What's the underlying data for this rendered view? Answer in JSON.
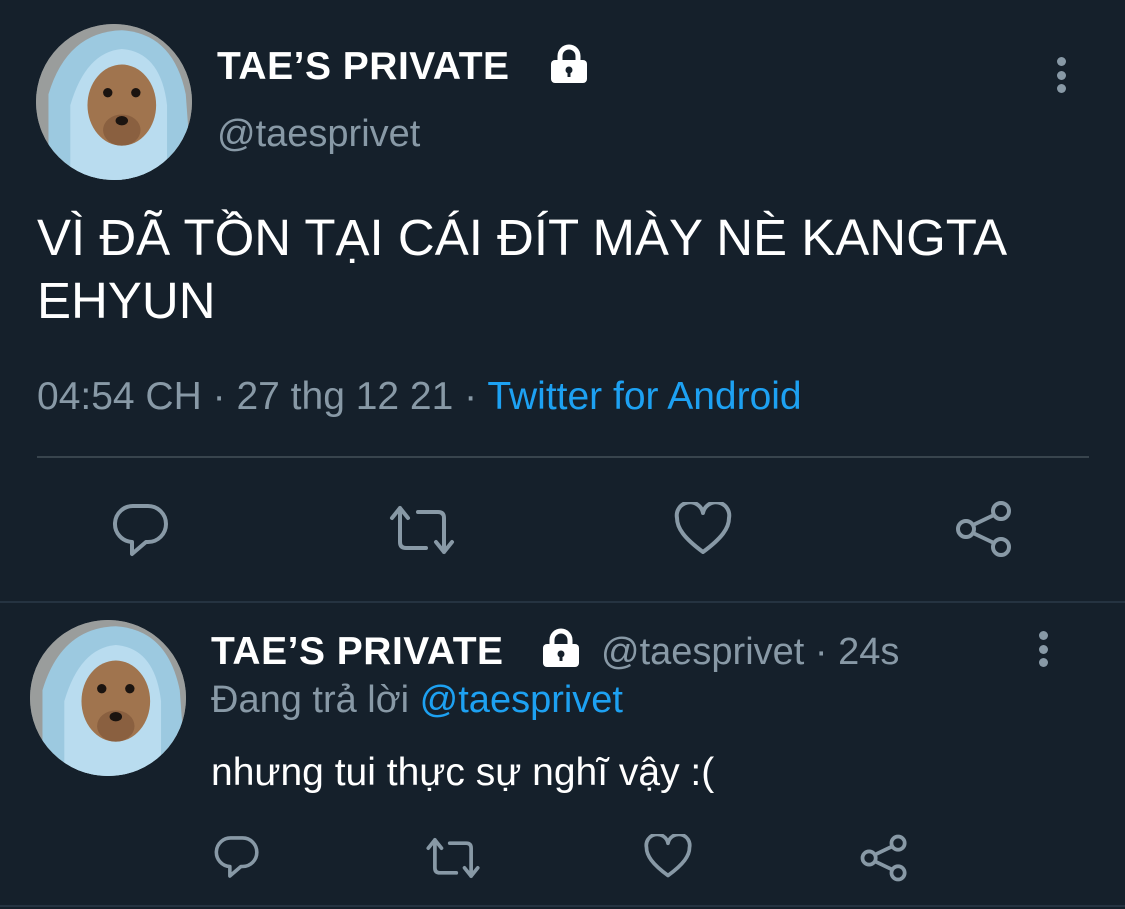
{
  "main_tweet": {
    "display_name": "TAE’S PRIVATE",
    "handle": "@taesprivet",
    "text_line1": "VÌ ĐÃ TỒN TẠI CÁI ĐÍT MÀY NÈ KANGTA",
    "text_line2": "EHYUN",
    "time": "04:54 CH",
    "dot1": "·",
    "date": "27 thg 12 21",
    "dot2": "·",
    "source": "Twitter for Android",
    "actions": [
      "reply-icon",
      "retweet-icon",
      "like-icon",
      "share-icon"
    ]
  },
  "reply_tweet": {
    "display_name": "TAE’S PRIVATE",
    "handle_time": "@taesprivet · 24s",
    "replying_prefix": "Đang trả lời",
    "replying_to": "@taesprivet",
    "text": "nhưng tui thực sự nghĩ vậy :(",
    "actions": [
      "reply-icon",
      "retweet-icon",
      "like-icon",
      "share-icon"
    ]
  },
  "colors": {
    "background": "#15202b",
    "text": "#ffffff",
    "muted": "#8899a6",
    "link": "#1da1f2",
    "divider": "#38444d"
  },
  "icons": {
    "lock": "lock-icon",
    "more": "more-icon",
    "avatar": "avatar-image"
  }
}
